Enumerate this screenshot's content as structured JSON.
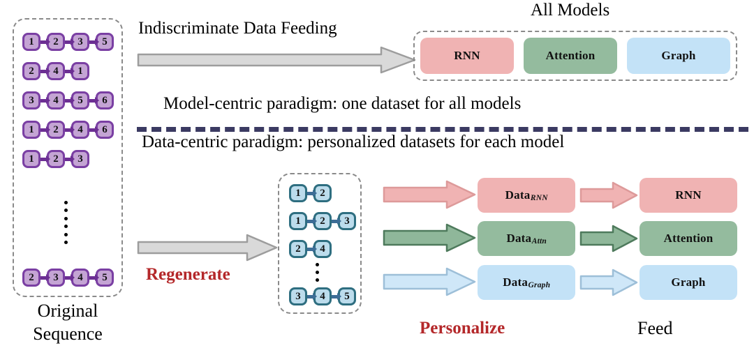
{
  "title_all_models": "All Models",
  "headings": {
    "indiscriminate": "Indiscriminate Data Feeding",
    "model_centric": "Model-centric paradigm: one dataset for all models",
    "data_centric": "Data-centric paradigm: personalized datasets for each model"
  },
  "left_panel": {
    "caption_line1": "Original",
    "caption_line2": "Sequence",
    "sequences": [
      [
        1,
        2,
        3,
        5
      ],
      [
        2,
        4,
        1
      ],
      [
        3,
        4,
        5,
        6
      ],
      [
        1,
        2,
        4,
        6
      ],
      [
        1,
        2,
        3
      ],
      [
        2,
        3,
        4,
        5
      ]
    ],
    "ellipsis_after_index": 4
  },
  "middle_panel": {
    "sequences": [
      [
        1,
        2
      ],
      [
        1,
        2,
        3
      ],
      [
        2,
        4
      ],
      [
        3,
        4,
        5
      ]
    ],
    "ellipsis_after_index": 2
  },
  "steps": {
    "regenerate": "Regenerate",
    "personalize": "Personalize",
    "feed": "Feed"
  },
  "all_models_chips": [
    {
      "label": "RNN",
      "color": "#f0b3b3",
      "kind": "rnn"
    },
    {
      "label": "Attention",
      "color": "#94bb9e",
      "kind": "attn"
    },
    {
      "label": "Graph",
      "color": "#c3e2f7",
      "kind": "graph"
    }
  ],
  "data_chips": [
    {
      "label": "Data",
      "sub": "RNN",
      "color": "#f0b3b3",
      "kind": "rnn"
    },
    {
      "label": "Data",
      "sub": "Attn",
      "color": "#94bb9e",
      "kind": "attn"
    },
    {
      "label": "Data",
      "sub": "Graph",
      "color": "#c3e2f7",
      "kind": "graph"
    }
  ],
  "model_chips": [
    {
      "label": "RNN",
      "color": "#f0b3b3",
      "kind": "rnn"
    },
    {
      "label": "Attention",
      "color": "#94bb9e",
      "kind": "attn"
    },
    {
      "label": "Graph",
      "color": "#c3e2f7",
      "kind": "graph"
    }
  ],
  "colors": {
    "node_purple_fill": "#c4a4d4",
    "node_purple_border": "#7a3fa3",
    "node_blue_fill": "#bcdcec",
    "node_blue_border": "#2e6e80",
    "gray_arrow_fill": "#d6d6d6",
    "gray_arrow_border": "#9a9a9a",
    "red_accent": "#b4282a",
    "divider": "#3b3a62",
    "dash_border": "#8a8a8a"
  }
}
